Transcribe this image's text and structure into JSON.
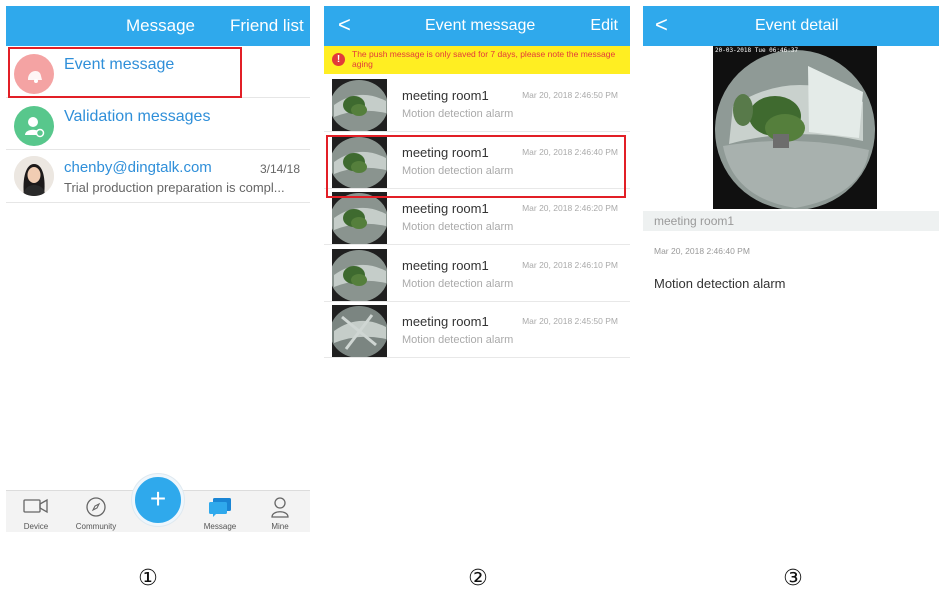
{
  "screen1": {
    "header": {
      "tab_message": "Message",
      "tab_friends": "Friend list"
    },
    "rows": [
      {
        "title": "Event message"
      },
      {
        "title": "Validation messages"
      }
    ],
    "contact": {
      "name": "chenby@dingtalk.com",
      "date": "3/14/18",
      "preview": "Trial production preparation is compl..."
    },
    "tabbar": [
      {
        "label": "Device",
        "icon": "camera-icon"
      },
      {
        "label": "Community",
        "icon": "compass-icon"
      },
      {
        "label": "",
        "icon": "plus-icon"
      },
      {
        "label": "Message",
        "icon": "chat-icon"
      },
      {
        "label": "Mine",
        "icon": "person-icon"
      }
    ],
    "fab_symbol": "+",
    "number": "①"
  },
  "screen2": {
    "header": {
      "back": "<",
      "title": "Event message",
      "edit": "Edit"
    },
    "notice": "The push message is only saved for 7 days, please note the message aging",
    "events": [
      {
        "name": "meeting room1",
        "time": "Mar 20, 2018 2:46:50 PM",
        "type": "Motion detection alarm"
      },
      {
        "name": "meeting room1",
        "time": "Mar 20, 2018 2:46:40 PM",
        "type": "Motion detection alarm"
      },
      {
        "name": "meeting room1",
        "time": "Mar 20, 2018 2:46:20 PM",
        "type": "Motion detection alarm"
      },
      {
        "name": "meeting room1",
        "time": "Mar 20, 2018 2:46:10 PM",
        "type": "Motion detection alarm"
      },
      {
        "name": "meeting room1",
        "time": "Mar 20, 2018 2:45:50 PM",
        "type": "Motion detection alarm"
      }
    ],
    "number": "②"
  },
  "screen3": {
    "header": {
      "back": "<",
      "title": "Event detail"
    },
    "image_overlay": "20-03-2018 Tue 06:46:37",
    "device": "meeting room1",
    "time": "Mar 20, 2018 2:46:40 PM",
    "type": "Motion detection alarm",
    "number": "③"
  },
  "colors": {
    "primary": "#2fa9ec",
    "link": "#2f8fd9",
    "highlight": "#e21f26",
    "notice_bg": "#ffee22",
    "notice_text": "#e23a3a"
  }
}
